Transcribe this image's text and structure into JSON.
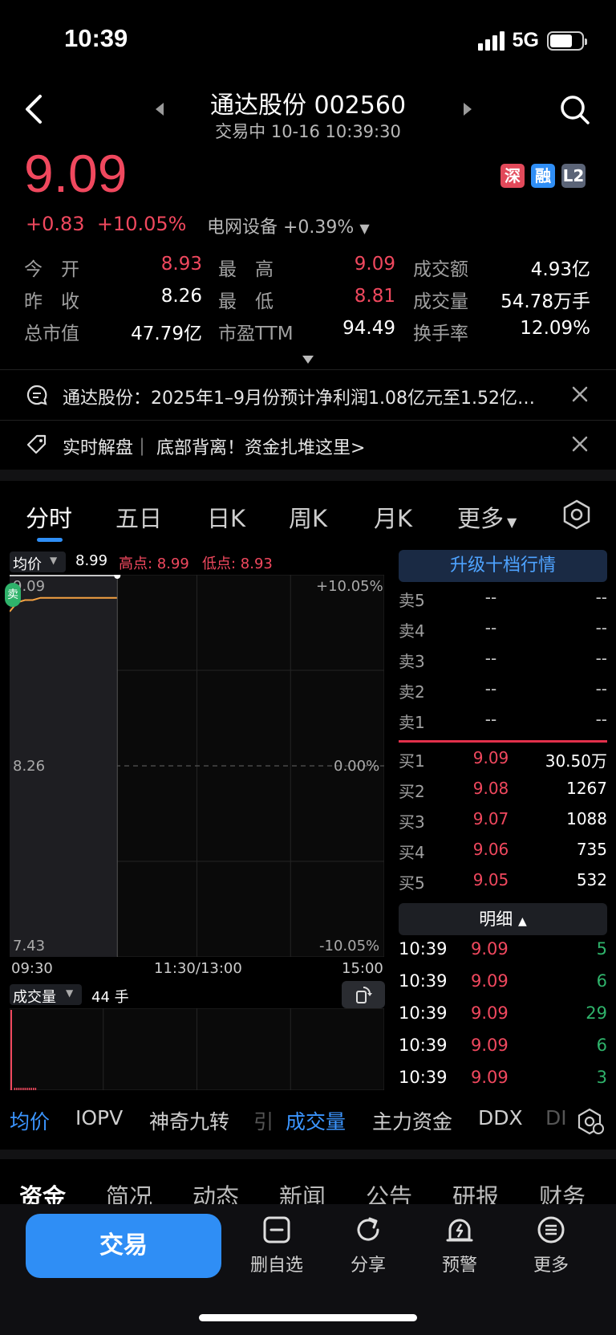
{
  "status_bar": {
    "time": "10:39",
    "network": "5G"
  },
  "header": {
    "title": "通达股份 002560",
    "subtitle": "交易中 10-16 10:39:30"
  },
  "price": {
    "last": "9.09",
    "change": "+0.83",
    "change_pct": "+10.05%",
    "sector": "电网设备 +0.39%"
  },
  "badges": [
    {
      "label": "深",
      "color": "#e2495a"
    },
    {
      "label": "融",
      "color": "#2f8ef5"
    },
    {
      "label": "L2",
      "color": "#5b6477"
    }
  ],
  "quote_rows": [
    [
      {
        "k": "今　开",
        "v": "8.93",
        "c": "red"
      },
      {
        "k": "最　高",
        "v": "9.09",
        "c": "red"
      },
      {
        "k": "成交额",
        "v": "4.93亿",
        "c": "white"
      }
    ],
    [
      {
        "k": "昨　收",
        "v": "8.26",
        "c": "white"
      },
      {
        "k": "最　低",
        "v": "8.81",
        "c": "red"
      },
      {
        "k": "成交量",
        "v": "54.78万手",
        "c": "white"
      }
    ],
    [
      {
        "k": "总市值",
        "v": "47.79亿",
        "c": "white"
      },
      {
        "k": "市盈TTM",
        "v": "94.49",
        "c": "white"
      },
      {
        "k": "换手率",
        "v": "12.09%",
        "c": "white"
      }
    ]
  ],
  "banners": {
    "news": "通达股份：2025年1–9月份预计净利润1.08亿元至1.52亿…",
    "promo": "实时解盘｜ 底部背离！资金扎堆这里>"
  },
  "chart_tabs": [
    "分时",
    "五日",
    "日K",
    "周K",
    "月K",
    "更多"
  ],
  "intraday": {
    "avg_label": "均价",
    "avg_value": "8.99",
    "high_label": "高点: 8.99",
    "low_label": "低点: 8.93",
    "y_top": "9.09",
    "y_mid": "8.26",
    "y_bottom": "7.43",
    "pct_top": "+10.05%",
    "pct_mid": "0.00%",
    "pct_bottom": "-10.05%",
    "x_labels": [
      "09:30",
      "11:30/13:00",
      "15:00"
    ],
    "sell_marker": "卖",
    "volume_label": "成交量",
    "volume_value": "44 手"
  },
  "chart_data": {
    "type": "line",
    "x": [
      "09:30",
      "09:35",
      "09:40",
      "09:45",
      "09:50",
      "09:55",
      "10:00",
      "10:05",
      "10:10",
      "10:15",
      "10:20",
      "10:25",
      "10:30",
      "10:35",
      "10:39"
    ],
    "series": [
      {
        "values": [
          8.93,
          8.97,
          8.98,
          8.98,
          8.99,
          8.99,
          8.99,
          8.99,
          8.99,
          8.99,
          8.99,
          8.99,
          8.99,
          8.99,
          8.99
        ]
      }
    ],
    "ylim": [
      7.43,
      9.09
    ]
  },
  "orderbook": {
    "upgrade_label": "升级十档行情",
    "asks": [
      {
        "k": "卖5",
        "p": "--",
        "v": "--"
      },
      {
        "k": "卖4",
        "p": "--",
        "v": "--"
      },
      {
        "k": "卖3",
        "p": "--",
        "v": "--"
      },
      {
        "k": "卖2",
        "p": "--",
        "v": "--"
      },
      {
        "k": "卖1",
        "p": "--",
        "v": "--"
      }
    ],
    "bids": [
      {
        "k": "买1",
        "p": "9.09",
        "v": "30.50万"
      },
      {
        "k": "买2",
        "p": "9.08",
        "v": "1267"
      },
      {
        "k": "买3",
        "p": "9.07",
        "v": "1088"
      },
      {
        "k": "买4",
        "p": "9.06",
        "v": "735"
      },
      {
        "k": "买5",
        "p": "9.05",
        "v": "532"
      }
    ],
    "detail_label": "明细",
    "ticks": [
      {
        "t": "10:39",
        "p": "9.09",
        "v": "5"
      },
      {
        "t": "10:39",
        "p": "9.09",
        "v": "6"
      },
      {
        "t": "10:39",
        "p": "9.09",
        "v": "29"
      },
      {
        "t": "10:39",
        "p": "9.09",
        "v": "6"
      },
      {
        "t": "10:39",
        "p": "9.09",
        "v": "3"
      }
    ]
  },
  "indicators": [
    "均价",
    "IOPV",
    "神奇九转",
    "引",
    "成交量",
    "主力资金",
    "DDX",
    "DI"
  ],
  "section_tabs": [
    "资金",
    "简况",
    "动态",
    "新闻",
    "公告",
    "研报",
    "财务"
  ],
  "bottom_bar": {
    "trade": "交易",
    "items": [
      "删自选",
      "分享",
      "预警",
      "更多"
    ]
  }
}
